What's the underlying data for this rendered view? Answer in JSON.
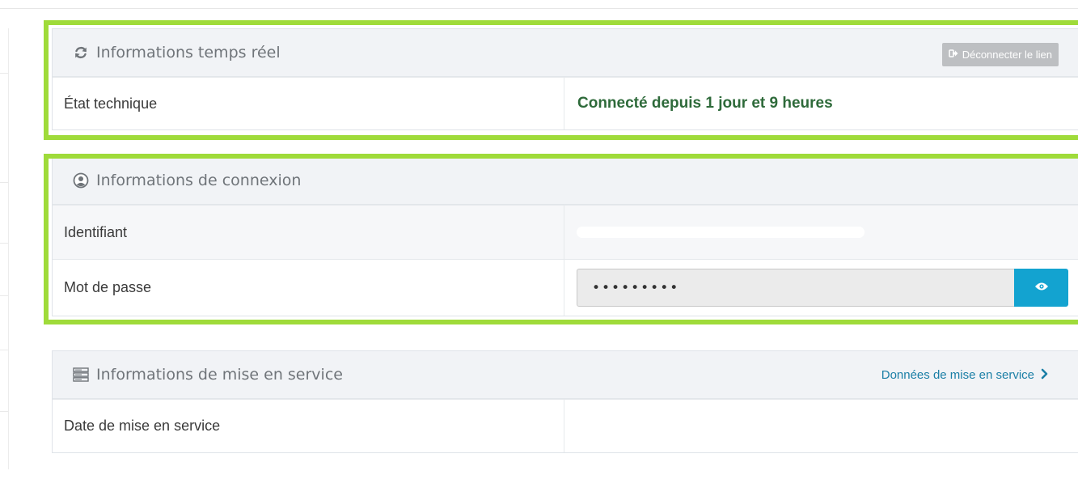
{
  "realtime": {
    "title": "Informations temps réel",
    "disconnect_label": "Déconnecter le lien",
    "rows": [
      {
        "label": "État technique",
        "value": "Connecté depuis 1 jour et 9 heures"
      }
    ]
  },
  "connexion": {
    "title": "Informations de connexion",
    "rows": [
      {
        "label": "Identifiant"
      },
      {
        "label": "Mot de passe",
        "value": "•••••••••"
      }
    ]
  },
  "service": {
    "title": "Informations de mise en service",
    "link_label": "Données de mise en service",
    "rows": [
      {
        "label": "Date de mise en service",
        "value": ""
      }
    ]
  },
  "colors": {
    "highlight": "#9fdb3a",
    "accent": "#13a3d0",
    "status_ok": "#2e6a3a",
    "link": "#1b7fa6"
  },
  "icons": {
    "realtime": "refresh-icon",
    "disconnect": "sign-out-icon",
    "connexion": "user-circle-icon",
    "password_toggle": "eye-icon",
    "service": "server-icon",
    "link": "chevron-right-icon"
  }
}
